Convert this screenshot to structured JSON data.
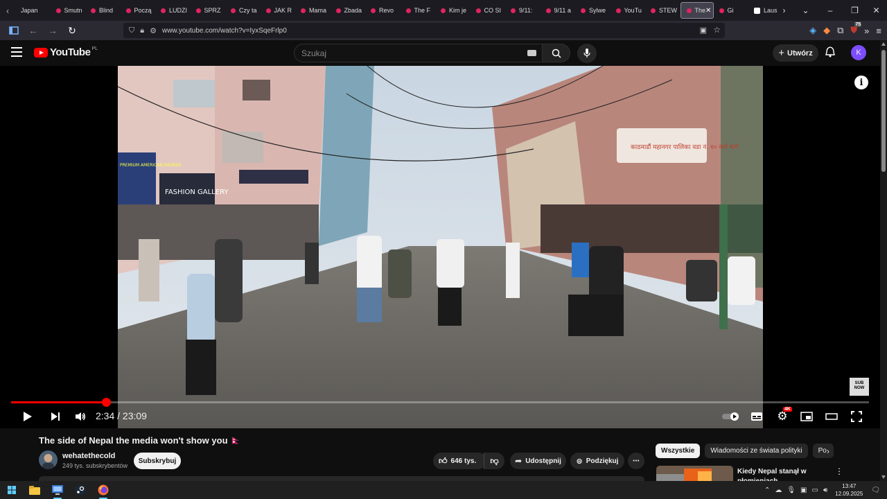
{
  "browser": {
    "tabs": [
      {
        "label": "Japan",
        "type": "plain"
      },
      {
        "label": "Smutn",
        "type": "yt"
      },
      {
        "label": "Blind",
        "type": "yt"
      },
      {
        "label": "Począ",
        "type": "yt"
      },
      {
        "label": "LUDZI",
        "type": "yt"
      },
      {
        "label": "SPRZ",
        "type": "yt"
      },
      {
        "label": "Czy ta",
        "type": "yt"
      },
      {
        "label": "JAK R",
        "type": "yt"
      },
      {
        "label": "Mama",
        "type": "yt"
      },
      {
        "label": "Zbada",
        "type": "yt"
      },
      {
        "label": "Revo",
        "type": "yt"
      },
      {
        "label": "The F",
        "type": "yt"
      },
      {
        "label": "Kim je",
        "type": "yt"
      },
      {
        "label": "CO SI",
        "type": "yt"
      },
      {
        "label": "9/11:",
        "type": "yt"
      },
      {
        "label": "9/11 a",
        "type": "yt"
      },
      {
        "label": "Sylwe",
        "type": "yt"
      },
      {
        "label": "YouTu",
        "type": "yt"
      },
      {
        "label": "STEW",
        "type": "yt"
      },
      {
        "label": "The",
        "type": "active"
      },
      {
        "label": "Gi",
        "type": "yt"
      },
      {
        "label": "Lausit",
        "type": "wiki"
      }
    ],
    "url": "www.youtube.com/watch?v=IyxSqeFrlp0",
    "extension_badge": "75"
  },
  "youtube": {
    "logo_text": "YouTube",
    "country_code": "PL",
    "search_placeholder": "Szukaj",
    "create_label": "Utwórz",
    "avatar_letter": "K"
  },
  "player": {
    "current_time": "2:34",
    "separator": " / ",
    "duration": "23:09",
    "progress_fraction": 0.111,
    "quality_badge": "4K",
    "watermark": "SUB NOW"
  },
  "video": {
    "title": "The side of Nepal the media won't show you 🇳🇵",
    "channel_name": "wehatethecold",
    "subscribers": "249 tys. subskrybentów",
    "subscribe_label": "Subskrybuj",
    "likes": "646 tys.",
    "share_label": "Udostępnij",
    "thanks_label": "Podziękuj"
  },
  "sidebar": {
    "chips": [
      "Wszystkie",
      "Wiadomości ze świata polityki",
      "Po"
    ],
    "recommended_title": "Kiedy Nepal stanął w płomieniach"
  },
  "taskbar": {
    "time": "13:47",
    "date": "12.09.2025"
  },
  "scene": {
    "sign_text": "काठमाडौं महानगर पालिका वडा नं. १० नयाँ मार्ग",
    "shop_sign_1": "FASHION GALLERY",
    "shop_sign_2": "PREMIUM AMERICAN DEGREE"
  }
}
